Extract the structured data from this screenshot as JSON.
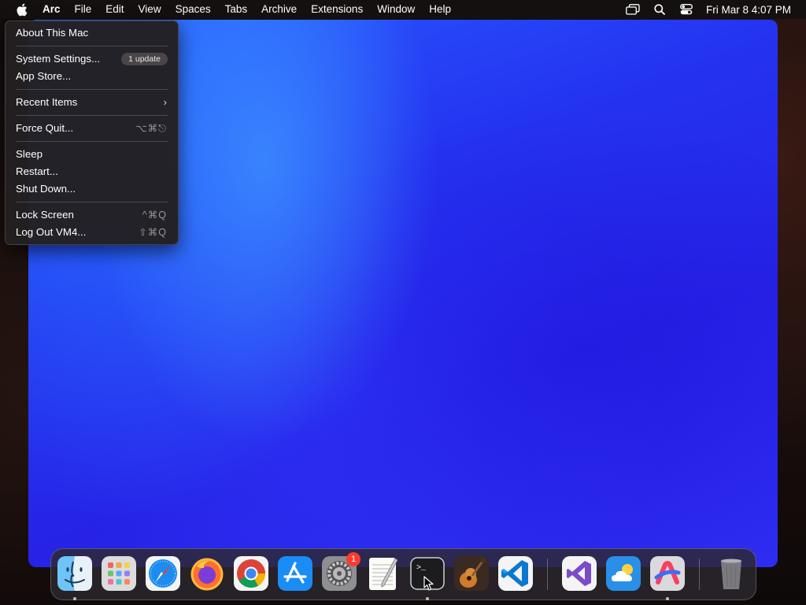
{
  "menubar": {
    "app_name": "Arc",
    "menus": [
      "File",
      "Edit",
      "View",
      "Spaces",
      "Tabs",
      "Archive",
      "Extensions",
      "Window",
      "Help"
    ],
    "clock": "Fri Mar 8  4:07 PM",
    "status_icons": [
      "screen-mirroring-icon",
      "spotlight-search-icon",
      "control-center-icon"
    ]
  },
  "apple_menu": {
    "about": "About This Mac",
    "system_settings": "System Settings...",
    "system_settings_badge": "1 update",
    "app_store": "App Store...",
    "recent_items": "Recent Items",
    "recent_items_chevron": "›",
    "force_quit": "Force Quit...",
    "force_quit_shortcut": "⌥⌘⎋",
    "sleep": "Sleep",
    "restart": "Restart...",
    "shut_down": "Shut Down...",
    "lock_screen": "Lock Screen",
    "lock_screen_shortcut": "^⌘Q",
    "log_out": "Log Out VM4...",
    "log_out_shortcut": "⇧⌘Q"
  },
  "dock": {
    "system_settings_badge": "1",
    "apps": [
      {
        "icon": "finder-icon",
        "running": true
      },
      {
        "icon": "launchpad-icon",
        "running": false
      },
      {
        "icon": "safari-icon",
        "running": false
      },
      {
        "icon": "firefox-icon",
        "running": false
      },
      {
        "icon": "chrome-icon",
        "running": false
      },
      {
        "icon": "app-store-icon",
        "running": false
      },
      {
        "icon": "system-settings-icon",
        "running": false
      },
      {
        "icon": "textedit-icon",
        "running": false
      },
      {
        "icon": "terminal-icon",
        "running": true
      },
      {
        "icon": "garageband-icon",
        "running": false
      },
      {
        "icon": "vscode-icon",
        "running": false
      },
      {
        "icon": "visual-studio-icon",
        "running": false
      },
      {
        "icon": "weather-icon",
        "running": false
      },
      {
        "icon": "arc-icon",
        "running": true
      },
      {
        "icon": "trash-icon",
        "running": false
      }
    ]
  },
  "colors": {
    "menubar_bg": "#151010",
    "menu_bg": "#242022",
    "badge_red": "#ff3b30"
  }
}
